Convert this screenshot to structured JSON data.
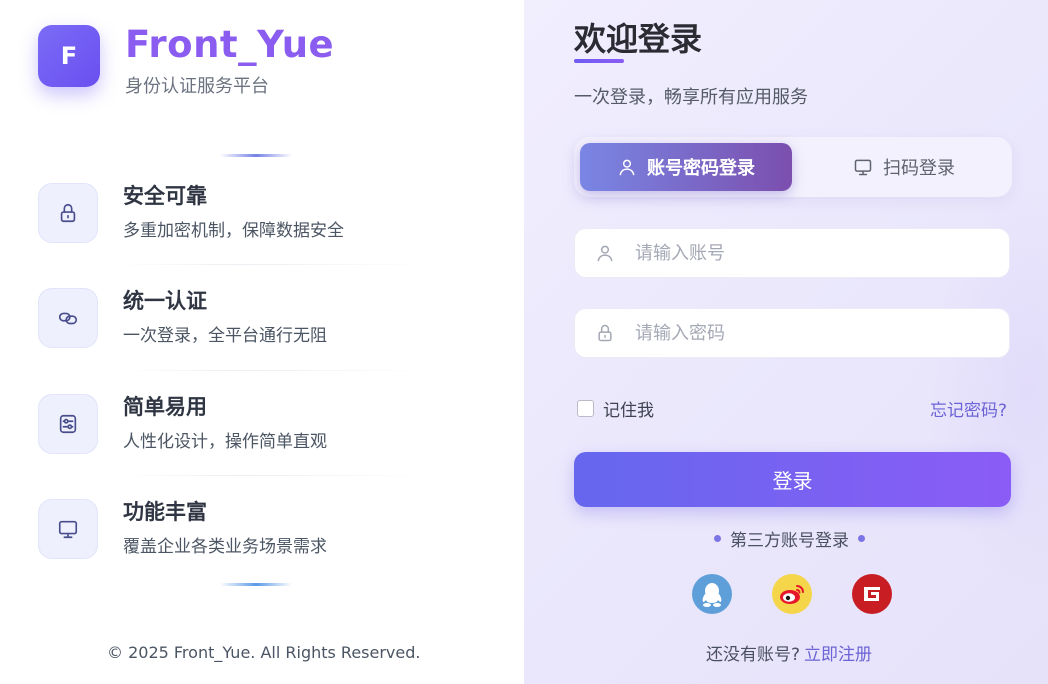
{
  "brand": {
    "logo_letter": "F",
    "name": "Front_Yue",
    "subtitle": "身份认证服务平台"
  },
  "features": [
    {
      "icon": "lock-icon",
      "title": "安全可靠",
      "desc": "多重加密机制，保障数据安全"
    },
    {
      "icon": "link-icon",
      "title": "统一认证",
      "desc": "一次登录，全平台通行无阻"
    },
    {
      "icon": "sliders-icon",
      "title": "简单易用",
      "desc": "人性化设计，操作简单直观"
    },
    {
      "icon": "monitor-icon",
      "title": "功能丰富",
      "desc": "覆盖企业各类业务场景需求"
    }
  ],
  "footer": {
    "copyright": "© 2025 Front_Yue. All Rights Reserved."
  },
  "login": {
    "title": "欢迎登录",
    "subtitle": "一次登录，畅享所有应用服务",
    "tabs": [
      {
        "label": "账号密码登录",
        "active": true
      },
      {
        "label": "扫码登录",
        "active": false
      }
    ],
    "username_placeholder": "请输入账号",
    "password_placeholder": "请输入密码",
    "remember_label": "记住我",
    "forgot_label": "忘记密码?",
    "submit_label": "登录",
    "third_party_label": "第三方账号登录",
    "third_party": [
      "qq-icon",
      "weibo-icon",
      "gitee-icon"
    ],
    "register_prompt": "还没有账号?",
    "register_link": "立即注册"
  },
  "colors": {
    "brand": "#8a5cf0",
    "accent": "#6567ee",
    "link": "#6b63d6",
    "right_bg": "#ebe8fc"
  }
}
